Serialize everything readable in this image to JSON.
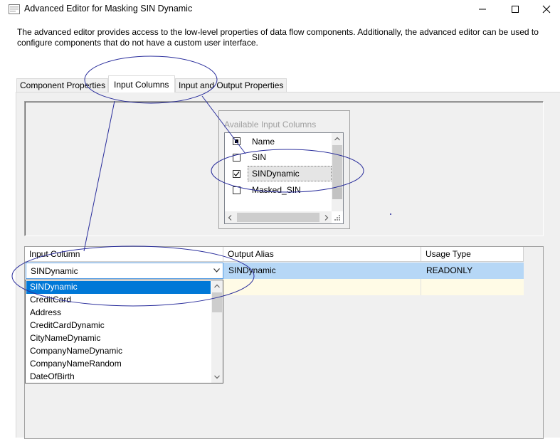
{
  "window": {
    "title": "Advanced Editor for Masking SIN Dynamic",
    "controls": {
      "minimize": "minimize-icon",
      "maximize": "maximize-icon",
      "close": "close-icon"
    }
  },
  "intro_text": "The advanced editor provides access to the low-level properties of data flow components. Additionally, the advanced editor can be used to configure components that do not have a custom user interface.",
  "tabs": [
    {
      "label": "Component Properties",
      "active": false
    },
    {
      "label": "Input Columns",
      "active": true
    },
    {
      "label": "Input and Output Properties",
      "active": false
    }
  ],
  "available_columns": {
    "title": "Available Input Columns",
    "header": {
      "label": "Name",
      "state": "indeterminate"
    },
    "rows": [
      {
        "label": "SIN",
        "checked": false
      },
      {
        "label": "SINDynamic",
        "checked": true
      },
      {
        "label": "Masked_SIN",
        "checked": false
      }
    ]
  },
  "grid": {
    "headers": [
      "Input Column",
      "Output Alias",
      "Usage Type"
    ],
    "rows": [
      {
        "input_column": "SINDynamic",
        "output_alias": "SINDynamic",
        "usage_type": "READONLY"
      }
    ]
  },
  "dropdown": {
    "selected": "SINDynamic",
    "options": [
      "SINDynamic",
      "CreditCard",
      "Address",
      "CreditCardDynamic",
      "CityNameDynamic",
      "CompanyNameDynamic",
      "CompanyNameRandom",
      "DateOfBirth"
    ]
  },
  "colors": {
    "selection": "#0078d7",
    "row_highlight": "#cce8ff",
    "new_row": "#fffbe6",
    "annotation": "#2a2e9c"
  }
}
